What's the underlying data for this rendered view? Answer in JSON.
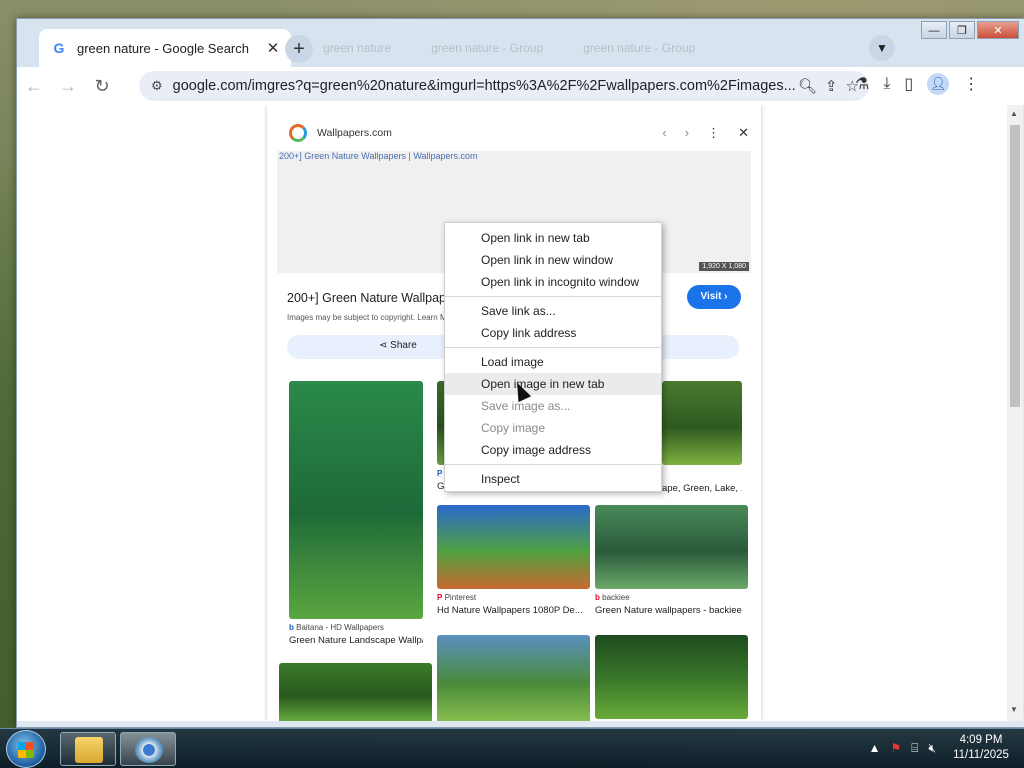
{
  "browser": {
    "tab_title": "green nature - Google Search",
    "tab_close": "✕",
    "new_tab": "+",
    "ghost_tabs": [
      "green nature",
      "green nature - Group",
      "green nature - Group"
    ],
    "url": "google.com/imgres?q=green%20nature&imgurl=https%3A%2F%2Fwallpapers.com%2Fimages...",
    "window_controls": [
      "—",
      "❐",
      "✕"
    ]
  },
  "panel": {
    "site_name": "Wallpapers.com",
    "image_alt": "200+] Green Nature Wallpapers | Wallpapers.com",
    "image_dims": "1,920 X 1,080",
    "result_title": "200+] Green Nature Wallpape",
    "visit_label": "Visit ›",
    "copyright": "Images may be subject to copyright. Learn M",
    "share_label": "Share"
  },
  "grid": [
    {
      "source": "Baitana - HD Wallpapers",
      "caption": "Green Nature Landscape Wallpa...",
      "src_icon": "b",
      "colors": [
        "#2a8a4a",
        "#1e6a38",
        "#5aa640"
      ]
    },
    {
      "source": "",
      "caption": "G",
      "src_icon": "P",
      "colors": [
        "#3c6a2a",
        "#2a5020",
        "#6a9a40"
      ]
    },
    {
      "source": "",
      "caption": "ape, Green, Lake, ...",
      "src_icon": "",
      "colors": [
        "#4a7a30",
        "#2e5a20",
        "#80b040"
      ]
    },
    {
      "source": "Pinterest",
      "caption": "Hd Nature Wallpapers 1080P De...",
      "src_icon": "P",
      "colors": [
        "#2a6acc",
        "#50a040",
        "#c86a30"
      ]
    },
    {
      "source": "backiee",
      "caption": "Green Nature wallpapers - backiee",
      "src_icon": "b",
      "colors": [
        "#4a8a5a",
        "#2a5a3a",
        "#6aaa6a"
      ]
    },
    {
      "source": "",
      "caption": "",
      "src_icon": "",
      "colors": [
        "#3a7a2a",
        "#2a5a1e",
        "#6ab040"
      ]
    },
    {
      "source": "",
      "caption": "",
      "src_icon": "",
      "colors": [
        "#5a90c0",
        "#4a8a3a",
        "#8ac050"
      ]
    },
    {
      "source": "",
      "caption": "",
      "src_icon": "",
      "colors": [
        "#1e4a1e",
        "#3a7a2a",
        "#6aaa3a"
      ]
    }
  ],
  "context_menu": {
    "group1": [
      "Open link in new tab",
      "Open link in new window",
      "Open link in incognito window"
    ],
    "group2": [
      "Save link as...",
      "Copy link address"
    ],
    "group3": [
      {
        "label": "Load image",
        "disabled": false
      },
      {
        "label": "Open image in new tab",
        "disabled": false
      },
      {
        "label": "Save image as...",
        "disabled": true
      },
      {
        "label": "Copy image",
        "disabled": true
      },
      {
        "label": "Copy image address",
        "disabled": false
      }
    ],
    "group4": [
      "Inspect"
    ]
  },
  "taskbar": {
    "time": "4:09 PM",
    "date": "11/11/2025"
  }
}
